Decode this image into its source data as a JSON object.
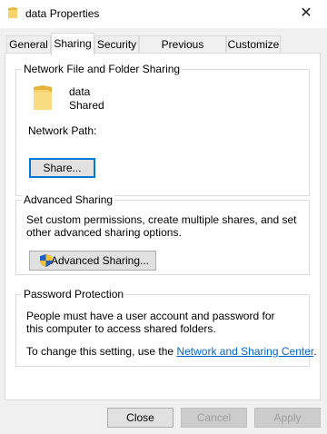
{
  "window": {
    "title": "data Properties",
    "close_glyph": "✕"
  },
  "tabs": [
    {
      "label": "General"
    },
    {
      "label": "Sharing",
      "active": true
    },
    {
      "label": "Security"
    },
    {
      "label": "Previous Versions"
    },
    {
      "label": "Customize"
    }
  ],
  "network_sharing": {
    "group_label": "Network File and Folder Sharing",
    "folder_name": "data",
    "share_status": "Shared",
    "network_path_label": "Network Path:",
    "share_button": "Share..."
  },
  "advanced_sharing": {
    "group_label": "Advanced Sharing",
    "description": "Set custom permissions, create multiple shares, and set other advanced sharing options.",
    "button": "Advanced Sharing..."
  },
  "password_protection": {
    "group_label": "Password Protection",
    "description": "People must have a user account and password for this computer to access shared folders.",
    "change_text": "To change this setting, use the ",
    "link_text": "Network and Sharing Center",
    "period": "."
  },
  "footer": {
    "close": "Close",
    "cancel": "Cancel",
    "apply": "Apply"
  },
  "colors": {
    "accent": "#0078d7",
    "link": "#0066cc",
    "folder": "#f3c54a"
  },
  "icons": {
    "title": "folder-icon",
    "folder": "folder-icon",
    "shield": "uac-shield-icon"
  }
}
